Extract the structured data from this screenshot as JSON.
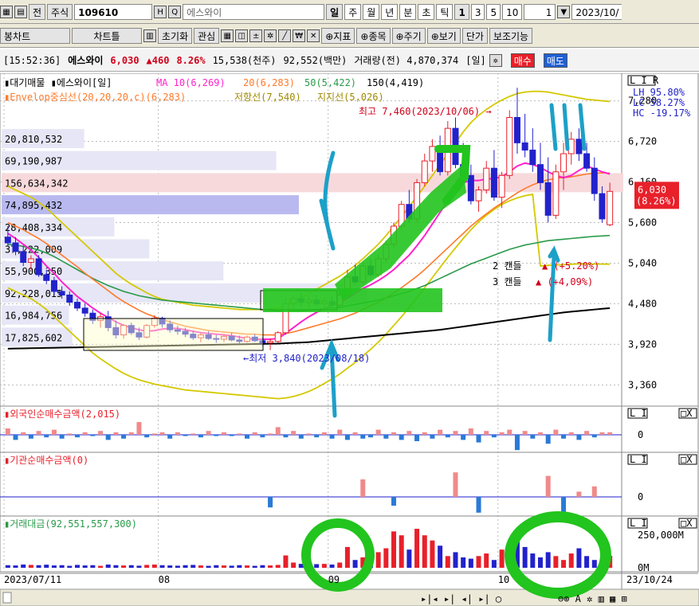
{
  "toolbar1": {
    "jeon": "전",
    "jusik": "주식",
    "code": "109610",
    "h": "H",
    "name": "에스와이",
    "periods": [
      "일",
      "주",
      "월",
      "년",
      "분",
      "초",
      "틱"
    ],
    "nums": [
      "1",
      "3",
      "5",
      "10"
    ],
    "count": "1",
    "date": "2023/10/"
  },
  "toolbar2": {
    "items": [
      "봉차트",
      "차트틀",
      "초기화",
      "관심",
      "지표",
      "종목",
      "주기",
      "보기",
      "단가",
      "보조기능"
    ]
  },
  "status": {
    "time": "[15:52:36]",
    "name": "에스와이",
    "price": "6,030",
    "change": "▲460",
    "pct": "8.26%",
    "vol_k": "15,538(천주)",
    "amount_m": "92,552(백만)",
    "prev_vol": "거래량(전) 4,870,374",
    "period": "[일]",
    "buy": "매수",
    "sell": "매도"
  },
  "chart_data": [
    {
      "type": "candlestick",
      "title": "에스와이[일]",
      "legend": [
        {
          "label": "대기매물",
          "color": "#000000"
        },
        {
          "label": "MA 10(6,269)",
          "color": "#ff00ff"
        },
        {
          "label": "20(6,283)",
          "color": "#ff6600"
        },
        {
          "label": "50(5,422)",
          "color": "#009933"
        },
        {
          "label": "150(4,419)",
          "color": "#000000"
        }
      ],
      "legend2": "Envelop중심선(20,20,20,c)(6,283)",
      "legend2b": "저항선(7,540)",
      "legend2c": "지지선(5,026)",
      "yticks": [
        "7,280",
        "6,720",
        "6,160",
        "5,600",
        "5,040",
        "4,480",
        "3,920",
        "3,360"
      ],
      "ytick_values": [
        7280,
        6720,
        6160,
        5600,
        5040,
        4480,
        3920,
        3360
      ],
      "ylim": [
        3100,
        7550
      ],
      "stats": [
        "LH 95.80%",
        "LC 58.27%",
        "HC -19.17%"
      ],
      "current": "6,030",
      "current_pct": "(8.26%)",
      "high_note": "최고 7,460(2023/10/06)",
      "low_note": "최저 3,840(2023/08/18)",
      "candle2": "2 캔들",
      "candle2_pct": "(+5.20%)",
      "candle3": "3 캔들",
      "candle3_pct": "(+4,09%)",
      "volume_profile": [
        {
          "label": "20,810,532",
          "value": 20810532
        },
        {
          "label": "69,190,987",
          "value": 69190987
        },
        {
          "label": "156,634,342",
          "value": 156634342
        },
        {
          "label": "74,895,432",
          "value": 74895432
        },
        {
          "label": "28,408,334",
          "value": 28408334
        },
        {
          "label": "37,222,009",
          "value": 37222009
        },
        {
          "label": "55,900,350",
          "value": 55900350
        },
        {
          "label": "92,228,015",
          "value": 92228015
        },
        {
          "label": "16,984,756",
          "value": 16984756
        },
        {
          "label": "17,825,602",
          "value": 17825602
        }
      ],
      "candles": [
        [
          5400,
          5550,
          5280,
          5320
        ],
        [
          5320,
          5400,
          5150,
          5200
        ],
        [
          5200,
          5280,
          5000,
          5050
        ],
        [
          5050,
          5150,
          4950,
          5100
        ],
        [
          5100,
          5150,
          4850,
          4880
        ],
        [
          4880,
          4950,
          4750,
          4800
        ],
        [
          4800,
          4850,
          4600,
          4650
        ],
        [
          4650,
          4720,
          4550,
          4600
        ],
        [
          4600,
          4650,
          4450,
          4500
        ],
        [
          4500,
          4550,
          4380,
          4420
        ],
        [
          4420,
          4480,
          4300,
          4350
        ],
        [
          4350,
          4400,
          4200,
          4250
        ],
        [
          4250,
          4350,
          4150,
          4300
        ],
        [
          4300,
          4380,
          4100,
          4150
        ],
        [
          4150,
          4250,
          4000,
          4050
        ],
        [
          4050,
          4200,
          4000,
          4180
        ],
        [
          4180,
          4220,
          4050,
          4080
        ],
        [
          4080,
          4150,
          3980,
          4020
        ],
        [
          4020,
          4200,
          4000,
          4180
        ],
        [
          4180,
          4320,
          4150,
          4280
        ],
        [
          4280,
          4300,
          4150,
          4200
        ],
        [
          4200,
          4250,
          4080,
          4120
        ],
        [
          4120,
          4180,
          4050,
          4100
        ],
        [
          4100,
          4150,
          4020,
          4060
        ],
        [
          4060,
          4100,
          3980,
          4010
        ],
        [
          4010,
          4080,
          3950,
          4050
        ],
        [
          4050,
          4100,
          3980,
          4000
        ],
        [
          4000,
          4050,
          3940,
          3990
        ],
        [
          3990,
          4060,
          3950,
          4030
        ],
        [
          4030,
          4080,
          3960,
          3980
        ],
        [
          3980,
          4040,
          3920,
          3960
        ],
        [
          3960,
          4040,
          3940,
          4020
        ],
        [
          4020,
          4060,
          3950,
          3970
        ],
        [
          3970,
          4020,
          3900,
          3940
        ],
        [
          3940,
          4000,
          3840,
          3960
        ],
        [
          3960,
          4100,
          3940,
          4080
        ],
        [
          4080,
          4560,
          4050,
          4480
        ],
        [
          4480,
          4600,
          4400,
          4550
        ],
        [
          4550,
          4620,
          4450,
          4500
        ],
        [
          4500,
          4580,
          4420,
          4530
        ],
        [
          4530,
          4600,
          4450,
          4480
        ],
        [
          4480,
          4560,
          4400,
          4510
        ],
        [
          4510,
          4580,
          4420,
          4460
        ],
        [
          4460,
          4650,
          4440,
          4600
        ],
        [
          4600,
          4950,
          4580,
          4850
        ],
        [
          4850,
          5020,
          4750,
          4780
        ],
        [
          4780,
          5050,
          4750,
          5000
        ],
        [
          5000,
          5100,
          4850,
          4880
        ],
        [
          4880,
          5150,
          4850,
          5100
        ],
        [
          5100,
          5350,
          5050,
          5300
        ],
        [
          5300,
          5600,
          5250,
          5550
        ],
        [
          5550,
          5900,
          5500,
          5850
        ],
        [
          5850,
          6050,
          5600,
          5650
        ],
        [
          5650,
          6200,
          5600,
          6150
        ],
        [
          6150,
          6550,
          6100,
          6450
        ],
        [
          6450,
          6750,
          6300,
          6650
        ],
        [
          6650,
          6800,
          6250,
          6300
        ],
        [
          6300,
          7000,
          6250,
          6900
        ],
        [
          6900,
          7050,
          6350,
          6400
        ],
        [
          6400,
          6700,
          6150,
          6250
        ],
        [
          6250,
          6400,
          5850,
          5900
        ],
        [
          5900,
          6100,
          5750,
          6050
        ],
        [
          6050,
          6450,
          6000,
          6350
        ],
        [
          6350,
          6600,
          5900,
          5950
        ],
        [
          5950,
          6300,
          5800,
          6250
        ],
        [
          6250,
          7150,
          6200,
          7050
        ],
        [
          7050,
          7460,
          6550,
          6700
        ],
        [
          6700,
          7100,
          6500,
          6600
        ],
        [
          6600,
          6900,
          6300,
          6400
        ],
        [
          6400,
          6700,
          6050,
          6150
        ],
        [
          6150,
          6500,
          5600,
          5700
        ],
        [
          5700,
          6400,
          5650,
          6300
        ],
        [
          6300,
          6700,
          6050,
          6550
        ],
        [
          6550,
          6850,
          6400,
          6750
        ],
        [
          6750,
          6900,
          6450,
          6550
        ],
        [
          6550,
          6700,
          6300,
          6350
        ],
        [
          6350,
          6500,
          5900,
          6000
        ],
        [
          6000,
          6100,
          5600,
          5650
        ],
        [
          5570,
          6150,
          5550,
          6030
        ]
      ],
      "ma10": [
        5450,
        5380,
        5300,
        5220,
        5120,
        5000,
        4900,
        4780,
        4680,
        4580,
        4500,
        4420,
        4350,
        4290,
        4230,
        4180,
        4150,
        4120,
        4100,
        4110,
        4130,
        4140,
        4140,
        4120,
        4100,
        4080,
        4070,
        4060,
        4050,
        4040,
        4020,
        4000,
        3990,
        3990,
        3990,
        4000,
        4070,
        4150,
        4230,
        4300,
        4360,
        4410,
        4460,
        4500,
        4560,
        4620,
        4690,
        4740,
        4800,
        4870,
        4950,
        5050,
        5150,
        5280,
        5420,
        5580,
        5740,
        5900,
        6050,
        6150,
        6180,
        6180,
        6200,
        6210,
        6230,
        6300,
        6380,
        6420,
        6400,
        6360,
        6300,
        6250,
        6220,
        6250,
        6320,
        6380,
        6340,
        6300,
        6269
      ],
      "ma20": [
        5600,
        5550,
        5500,
        5440,
        5380,
        5310,
        5230,
        5150,
        5070,
        4990,
        4900,
        4820,
        4740,
        4660,
        4580,
        4510,
        4450,
        4390,
        4340,
        4300,
        4260,
        4230,
        4200,
        4170,
        4150,
        4130,
        4110,
        4100,
        4090,
        4080,
        4070,
        4060,
        4060,
        4050,
        4050,
        4050,
        4070,
        4090,
        4120,
        4150,
        4180,
        4210,
        4240,
        4270,
        4310,
        4350,
        4400,
        4450,
        4500,
        4560,
        4630,
        4700,
        4780,
        4860,
        4950,
        5050,
        5150,
        5250,
        5350,
        5450,
        5550,
        5640,
        5720,
        5800,
        5870,
        5940,
        6010,
        6070,
        6120,
        6160,
        6190,
        6210,
        6220,
        6230,
        6250,
        6270,
        6280,
        6285,
        6283
      ],
      "ma50": [
        5300,
        5290,
        5270,
        5250,
        5220,
        5180,
        5130,
        5070,
        5010,
        4950,
        4890,
        4830,
        4780,
        4730,
        4690,
        4650,
        4620,
        4590,
        4570,
        4550,
        4530,
        4520,
        4510,
        4500,
        4490,
        4480,
        4470,
        4460,
        4450,
        4440,
        4430,
        4420,
        4410,
        4400,
        4390,
        4380,
        4380,
        4380,
        4380,
        4390,
        4400,
        4410,
        4420,
        4430,
        4450,
        4470,
        4490,
        4510,
        4530,
        4560,
        4590,
        4620,
        4650,
        4690,
        4730,
        4780,
        4830,
        4880,
        4930,
        4980,
        5030,
        5070,
        5110,
        5150,
        5190,
        5230,
        5260,
        5290,
        5310,
        5330,
        5350,
        5360,
        5370,
        5380,
        5390,
        5400,
        5410,
        5415,
        5422
      ],
      "ma150": [
        3860,
        3862,
        3864,
        3866,
        3868,
        3870,
        3872,
        3874,
        3876,
        3878,
        3880,
        3882,
        3884,
        3886,
        3888,
        3890,
        3892,
        3894,
        3896,
        3898,
        3900,
        3902,
        3904,
        3906,
        3908,
        3910,
        3912,
        3914,
        3916,
        3918,
        3920,
        3922,
        3924,
        3926,
        3928,
        3930,
        3935,
        3940,
        3945,
        3950,
        3960,
        3970,
        3980,
        3990,
        4000,
        4010,
        4020,
        4030,
        4040,
        4050,
        4060,
        4070,
        4080,
        4090,
        4100,
        4110,
        4120,
        4135,
        4150,
        4165,
        4180,
        4195,
        4210,
        4225,
        4240,
        4255,
        4270,
        4285,
        4300,
        4315,
        4330,
        4345,
        4360,
        4370,
        4380,
        4390,
        4400,
        4410,
        4419
      ],
      "env_upper": [
        6100,
        6050,
        6000,
        5950,
        5880,
        5800,
        5700,
        5600,
        5500,
        5400,
        5300,
        5200,
        5100,
        5000,
        4900,
        4820,
        4750,
        4690,
        4630,
        4580,
        4540,
        4520,
        4500,
        4480,
        4460,
        4450,
        4440,
        4430,
        4420,
        4410,
        4400,
        4400,
        4400,
        4400,
        4410,
        4420,
        4460,
        4510,
        4560,
        4620,
        4680,
        4740,
        4800,
        4860,
        4930,
        5010,
        5100,
        5200,
        5300,
        5420,
        5550,
        5680,
        5820,
        5960,
        6100,
        6250,
        6400,
        6550,
        6700,
        6850,
        6980,
        7080,
        7160,
        7230,
        7290,
        7340,
        7380,
        7400,
        7410,
        7410,
        7400,
        7380,
        7360,
        7340,
        7320,
        7300,
        7290,
        7280,
        7270
      ],
      "env_lower": [
        4700,
        4650,
        4600,
        4550,
        4480,
        4400,
        4300,
        4200,
        4100,
        4000,
        3900,
        3800,
        3720,
        3650,
        3580,
        3520,
        3470,
        3430,
        3400,
        3370,
        3350,
        3330,
        3310,
        3290,
        3280,
        3270,
        3260,
        3250,
        3240,
        3230,
        3220,
        3210,
        3200,
        3190,
        3180,
        3170,
        3180,
        3200,
        3230,
        3270,
        3320,
        3380,
        3440,
        3510,
        3590,
        3670,
        3760,
        3850,
        3950,
        4060,
        4180,
        4300,
        4430,
        4560,
        4700,
        4840,
        4980,
        5120,
        5250,
        5380,
        5500,
        5610,
        5700,
        5780,
        5850,
        5900,
        5940,
        5970,
        5990,
        5000,
        5010,
        5015,
        5020,
        5025,
        5030,
        5030,
        5028,
        5027,
        5026
      ]
    },
    {
      "type": "bar",
      "title": "외국인순매수금액(2,015)",
      "yticks": [
        "0"
      ],
      "values": [
        5,
        -4,
        2,
        -3,
        3,
        -2,
        4,
        -3,
        1,
        -2,
        2,
        -1,
        3,
        -4,
        2,
        -3,
        2,
        10,
        -2,
        1,
        2,
        -3,
        2,
        -1,
        1,
        -2,
        3,
        -1,
        2,
        -1,
        1,
        -3,
        2,
        -2,
        1,
        6,
        -2,
        3,
        -3,
        1,
        -2,
        2,
        -3,
        4,
        -4,
        2,
        -3,
        -2,
        4,
        -3,
        2,
        -4,
        3,
        -5,
        2,
        -3,
        4,
        -2,
        3,
        -4,
        5,
        -6,
        3,
        -2,
        2,
        4,
        -12,
        3,
        -3,
        2,
        -7,
        4,
        -3,
        2,
        -4,
        3,
        -2,
        2,
        2
      ]
    },
    {
      "type": "bar",
      "title": "기관순매수금액(0)",
      "yticks": [
        "0"
      ],
      "values": [
        0,
        0,
        0,
        0,
        0,
        0,
        0,
        0,
        0,
        0,
        0,
        0,
        0,
        0,
        0,
        0,
        0,
        0,
        0,
        0,
        0,
        0,
        0,
        0,
        0,
        0,
        0,
        0,
        0,
        0,
        0,
        0,
        0,
        0,
        -6,
        0,
        0,
        0,
        0,
        0,
        0,
        0,
        0,
        0,
        0,
        0,
        10,
        0,
        0,
        0,
        -5,
        0,
        0,
        0,
        0,
        0,
        0,
        0,
        14,
        0,
        0,
        -9,
        0,
        0,
        0,
        0,
        0,
        0,
        0,
        0,
        12,
        0,
        -10,
        0,
        3,
        0,
        6,
        0,
        0
      ]
    },
    {
      "type": "bar",
      "title": "거래대금(92,551,557,300)",
      "yticks": [
        "250,000M",
        "0M"
      ],
      "ytick_values": [
        250000,
        0
      ],
      "ylim": [
        0,
        380000
      ],
      "values": [
        20,
        18,
        25,
        22,
        20,
        24,
        18,
        20,
        15,
        22,
        18,
        20,
        15,
        25,
        20,
        18,
        20,
        16,
        22,
        25,
        20,
        18,
        16,
        20,
        22,
        18,
        15,
        20,
        18,
        16,
        20,
        18,
        15,
        20,
        18,
        22,
        95,
        40,
        30,
        35,
        28,
        30,
        25,
        40,
        160,
        60,
        80,
        55,
        120,
        150,
        280,
        250,
        140,
        300,
        250,
        210,
        170,
        90,
        120,
        80,
        70,
        90,
        110,
        60,
        140,
        120,
        210,
        160,
        110,
        80,
        120,
        90,
        60,
        110,
        150,
        90,
        60,
        30,
        92.5
      ],
      "dates": [
        "2023/07/11",
        "08",
        "09",
        "10",
        "23/10/24"
      ]
    }
  ]
}
